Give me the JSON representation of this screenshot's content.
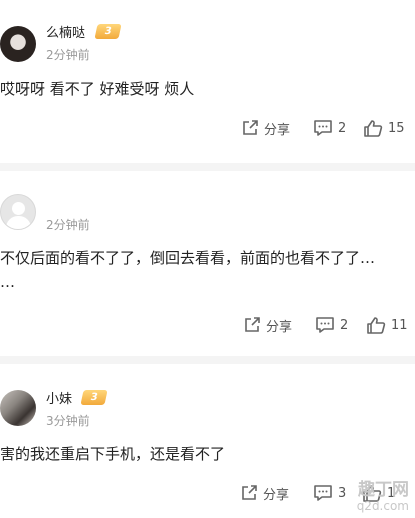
{
  "comments": [
    {
      "username": "么楠哒",
      "badge": "3",
      "time": "2分钟前",
      "content": "哎呀呀 看不了 好难受呀 烦人",
      "share_label": "分享",
      "comment_count": "2",
      "like_count": "15"
    },
    {
      "username": "",
      "badge": "",
      "time": "2分钟前",
      "content": "不仅后面的看不了了，倒回去看看，前面的也看不了了…\n…",
      "share_label": "分享",
      "comment_count": "2",
      "like_count": "11"
    },
    {
      "username": "小妹",
      "badge": "3",
      "time": "3分钟前",
      "content": "害的我还重启下手机，还是看不了",
      "share_label": "分享",
      "comment_count": "3",
      "like_count": "1"
    }
  ],
  "watermark": {
    "main": "趣丁网",
    "sub": "q2d.com"
  },
  "icons": {
    "share": "share-icon",
    "comment": "comment-icon",
    "like": "thumbs-up-icon",
    "badge": "level-badge-icon"
  },
  "colors": {
    "badge": "#f2a93b",
    "secondary_text": "#999999",
    "divider": "#f4f4f4"
  }
}
